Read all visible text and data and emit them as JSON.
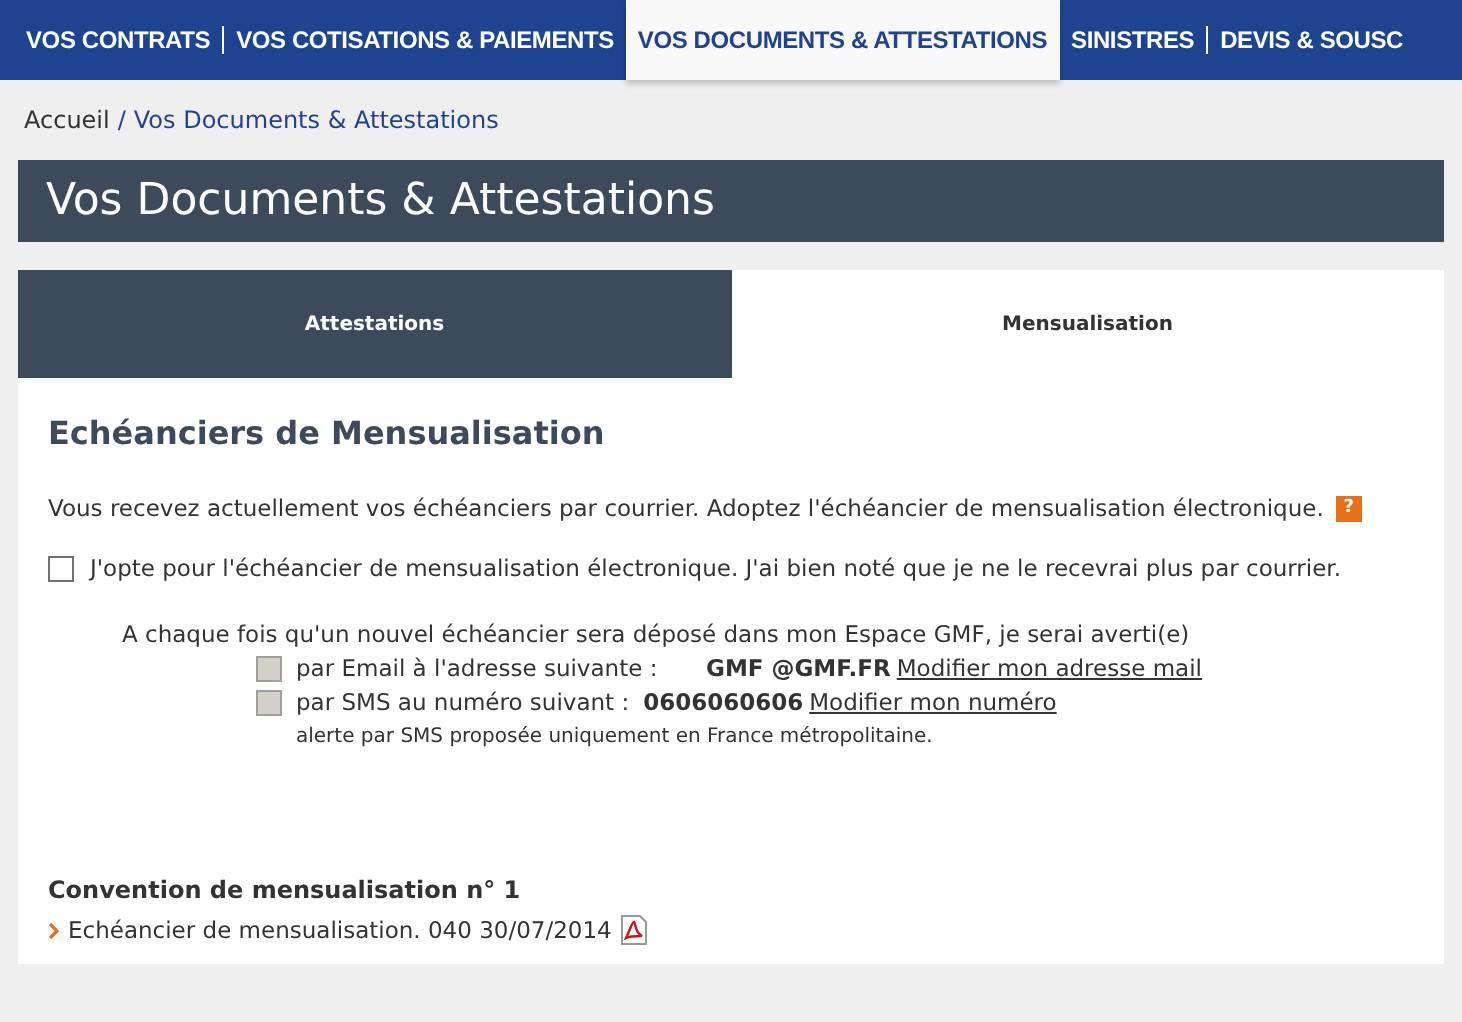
{
  "nav": [
    {
      "label": "VOS CONTRATS",
      "selected": false
    },
    {
      "label": "VOS COTISATIONS & PAIEMENTS",
      "selected": false
    },
    {
      "label": "VOS DOCUMENTS & ATTESTATIONS",
      "selected": true
    },
    {
      "label": "SINISTRES",
      "selected": false
    },
    {
      "label": "DEVIS & SOUSC",
      "selected": false
    }
  ],
  "breadcrumb": {
    "home": "Accueil",
    "separator": "/",
    "current": "Vos Documents & Attestations"
  },
  "page_title": "Vos Documents & Attestations",
  "tabs": [
    {
      "label": "Attestations",
      "selected": false
    },
    {
      "label": "Mensualisation",
      "selected": true
    }
  ],
  "section_title": "Echéanciers de Mensualisation",
  "intro": "Vous recevez actuellement vos échéanciers par courrier. Adoptez l'échéancier de mensualisation électronique.",
  "help_badge": "?",
  "opt_in": {
    "label": "J'opte pour l'échéancier de mensualisation électronique. J'ai bien noté que je ne le recevrai plus par courrier.",
    "checked": false,
    "disabled": false
  },
  "notify_text": "A chaque fois qu'un nouvel échéancier sera déposé dans mon Espace GMF, je serai averti(e)",
  "channels": [
    {
      "label": "par Email à l'adresse suivante :",
      "value": "GMF @GMF.FR",
      "link": "Modifier mon adresse mail",
      "checked": false,
      "disabled": true
    },
    {
      "label": "par SMS au numéro suivant :",
      "value": "0606060606",
      "link": "Modifier mon numéro",
      "checked": false,
      "disabled": true
    }
  ],
  "sms_note": "alerte par SMS proposée uniquement en France métropolitaine.",
  "convention": {
    "title": "Convention de mensualisation n° 1",
    "documents": [
      {
        "label": "Echéancier de mensualisation. 040 30/07/2014"
      }
    ]
  }
}
